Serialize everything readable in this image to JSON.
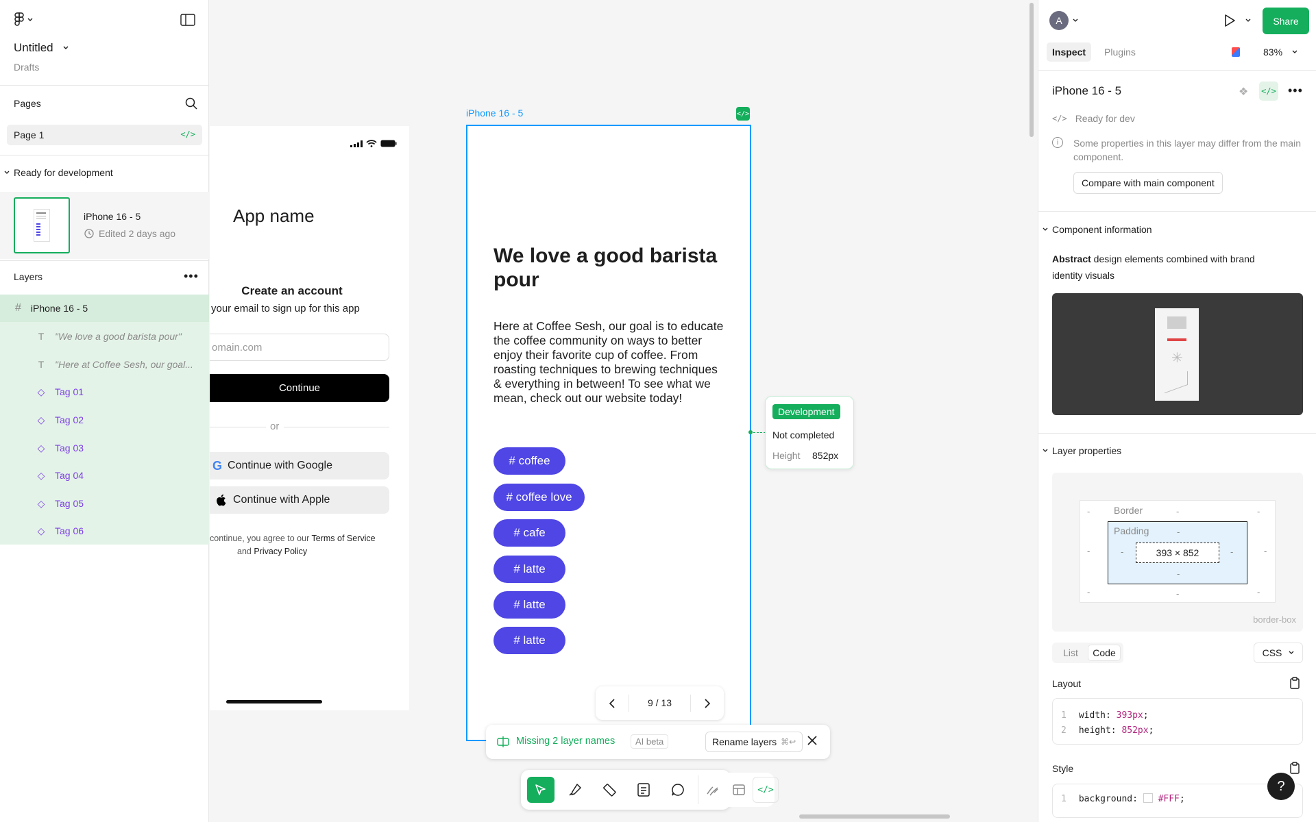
{
  "left": {
    "file_title": "Untitled",
    "file_location": "Drafts",
    "pages_heading": "Pages",
    "current_page": "Page 1",
    "ready_heading": "Ready for development",
    "ready_item": {
      "name": "iPhone 16 - 5",
      "meta": "Edited 2 days ago"
    },
    "layers_heading": "Layers",
    "layers": [
      {
        "name": "iPhone 16 - 5",
        "kind": "frame"
      },
      {
        "name": "\"We love a good barista pour\"",
        "kind": "text"
      },
      {
        "name": "\"Here at Coffee Sesh, our goal...",
        "kind": "text"
      },
      {
        "name": "Tag 01",
        "kind": "component"
      },
      {
        "name": "Tag 02",
        "kind": "component"
      },
      {
        "name": "Tag 03",
        "kind": "component"
      },
      {
        "name": "Tag 04",
        "kind": "component"
      },
      {
        "name": "Tag 05",
        "kind": "component"
      },
      {
        "name": "Tag 06",
        "kind": "component"
      }
    ]
  },
  "signup": {
    "app_name": "App name",
    "heading": "Create an account",
    "sub": "your email to sign up for this app",
    "email_placeholder": "omain.com",
    "continue": "Continue",
    "or": "or",
    "google": "Continue with Google",
    "apple": "Continue with Apple",
    "legal_1": "continue, you agree to our",
    "terms": "Terms of Service",
    "legal_and": "and",
    "privacy": "Privacy Policy"
  },
  "frame": {
    "label": "iPhone 16 - 5",
    "headline": "We love a good barista pour",
    "body": "Here at Coffee Sesh, our goal is to educate the coffee community on ways to better enjoy their favorite cup of coffee. From roasting techniques to brewing techniques & everything in between! To see what we mean, check out our website today!",
    "tags": [
      "# coffee",
      "# coffee love",
      "# cafe",
      "# latte",
      "# latte",
      "# latte"
    ]
  },
  "dev_popover": {
    "status": "Development",
    "state": "Not completed",
    "height_label": "Height",
    "height_value": "852px"
  },
  "pager": {
    "text": "9 / 13"
  },
  "ai_bar": {
    "message": "Missing 2 layer names",
    "badge": "AI beta",
    "action": "Rename layers",
    "shortcut": "⌘↩"
  },
  "toolbar": {
    "tools": [
      "move-tool",
      "pen-tool",
      "measure-tool",
      "annotate-tool",
      "comment-tool",
      "draw-tool",
      "dev-resources-tool",
      "dev-mode-tool"
    ]
  },
  "right": {
    "avatar": "A",
    "share": "Share",
    "tab_inspect": "Inspect",
    "tab_plugins": "Plugins",
    "zoom": "83%",
    "layer_title": "iPhone 16 - 5",
    "ready": "Ready for dev",
    "notice": "Some properties in this layer may differ from the main component.",
    "compare_btn": "Compare with main component",
    "component_info_heading": "Component information",
    "desc_bold": "Abstract",
    "desc_rest": " design elements combined with brand identity visuals",
    "layer_props_heading": "Layer properties",
    "box_border": "Border",
    "box_padding": "Padding",
    "box_size": "393 × 852",
    "box_dash": "-",
    "box_sizing": "border-box",
    "seg_list": "List",
    "seg_code": "Code",
    "lang": "CSS",
    "layout_heading": "Layout",
    "layout_code": [
      {
        "ln": "1",
        "prop": "width:",
        "val": "393px"
      },
      {
        "ln": "2",
        "prop": "height:",
        "val": "852px"
      }
    ],
    "style_heading": "Style",
    "style_code": {
      "ln": "1",
      "prop": "background:",
      "val": "#FFF"
    },
    "help": "?"
  },
  "colors": {
    "accent_green": "#14ae5c",
    "tag_purple": "#4f46e5",
    "frame_blue": "#0d99ff",
    "component_purple": "#7b3fe4"
  }
}
